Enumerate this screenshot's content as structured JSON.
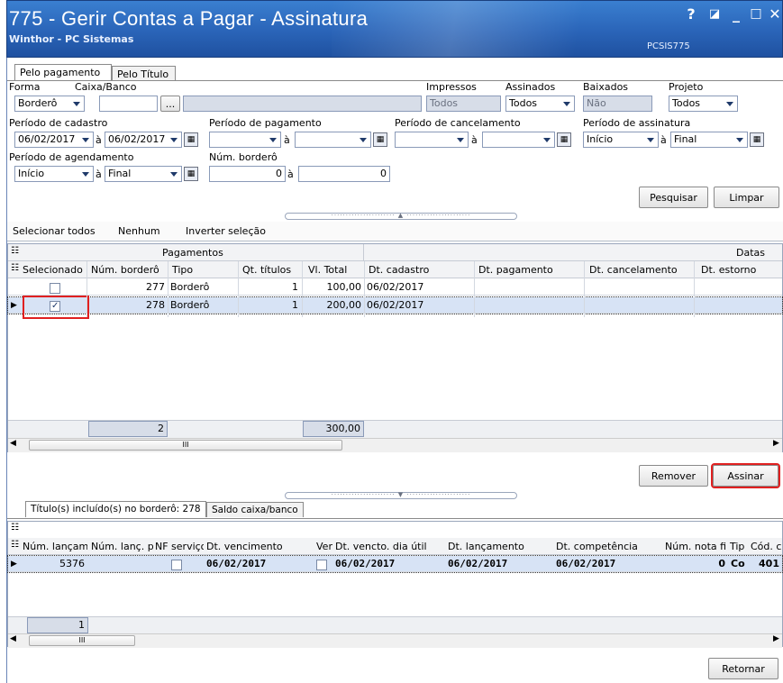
{
  "window": {
    "title": "775 - Gerir Contas a Pagar - Assinatura",
    "subtitle": "Winthor - PC Sistemas",
    "code": "PCSIS775",
    "controls": [
      "?",
      "◪",
      "_",
      "□",
      "✕"
    ]
  },
  "tabs": [
    "Pelo pagamento",
    "Pelo Título"
  ],
  "filters": {
    "forma_label": "Forma",
    "forma_value": "Borderô",
    "caixa_label": "Caixa/Banco",
    "caixa_btn": "...",
    "impressos_label": "Impressos",
    "impressos_value": "Todos",
    "assinados_label": "Assinados",
    "assinados_value": "Todos",
    "baixados_label": "Baixados",
    "baixados_value": "Não",
    "projeto_label": "Projeto",
    "projeto_value": "Todos",
    "periodo_cadastro_label": "Período de cadastro",
    "cadastro_from": "06/02/2017",
    "cadastro_to": "06/02/2017",
    "periodo_pagamento_label": "Período de pagamento",
    "periodo_cancelamento_label": "Período de cancelamento",
    "periodo_assinatura_label": "Período de assinatura",
    "assinatura_from": "Início",
    "assinatura_to": "Final",
    "periodo_agendamento_label": "Período de agendamento",
    "agendamento_from": "Início",
    "agendamento_to": "Final",
    "num_bordero_label": "Núm. borderô",
    "bordero_from": "0",
    "bordero_to": "0",
    "a_sep": "à"
  },
  "actions": {
    "search": "Pesquisar",
    "clear": "Limpar",
    "remove": "Remover",
    "sign": "Assinar",
    "return": "Retornar"
  },
  "selection_toolbar": [
    "Selecionar todos",
    "Nenhum",
    "Inverter seleção"
  ],
  "grid": {
    "band_payments": "Pagamentos",
    "band_dates": "Datas",
    "columns": [
      "Selecionado",
      "Núm. borderô",
      "Tipo",
      "Qt. títulos",
      "Vl. Total",
      "Dt. cadastro",
      "Dt. pagamento",
      "Dt. cancelamento",
      "Dt. estorno"
    ],
    "rows": [
      {
        "selected": false,
        "num": "277",
        "tipo": "Borderô",
        "qt": "1",
        "total": "100,00",
        "cadastro": "06/02/2017"
      },
      {
        "selected": true,
        "num": "278",
        "tipo": "Borderô",
        "qt": "1",
        "total": "200,00",
        "cadastro": "06/02/2017"
      }
    ],
    "footer_count": "2",
    "footer_total": "300,00",
    "scroll_grip": "III"
  },
  "bottom_tabs": [
    "Título(s) incluído(s) no borderô: 278",
    "Saldo caixa/banco"
  ],
  "titles_grid": {
    "columns": [
      "Núm. lançam",
      "Núm. lanç. p",
      "NF serviço",
      "Dt. vencimento",
      "Ver",
      "Dt. vencto. dia útil",
      "Dt. lançamento",
      "Dt. competência",
      "Núm. nota fi",
      "Tip",
      "Cód. co"
    ],
    "row": {
      "num": "5376",
      "vencimento": "06/02/2017",
      "vencto_util": "06/02/2017",
      "lancamento": "06/02/2017",
      "competencia": "06/02/2017",
      "nota": "0",
      "tip": "Co",
      "cod": "401"
    },
    "footer_count": "1",
    "scroll_grip": "III"
  },
  "colors": {
    "title_bar": "#2a64b8",
    "highlight": "#e02020",
    "selected_row": "#d7e3f5"
  }
}
